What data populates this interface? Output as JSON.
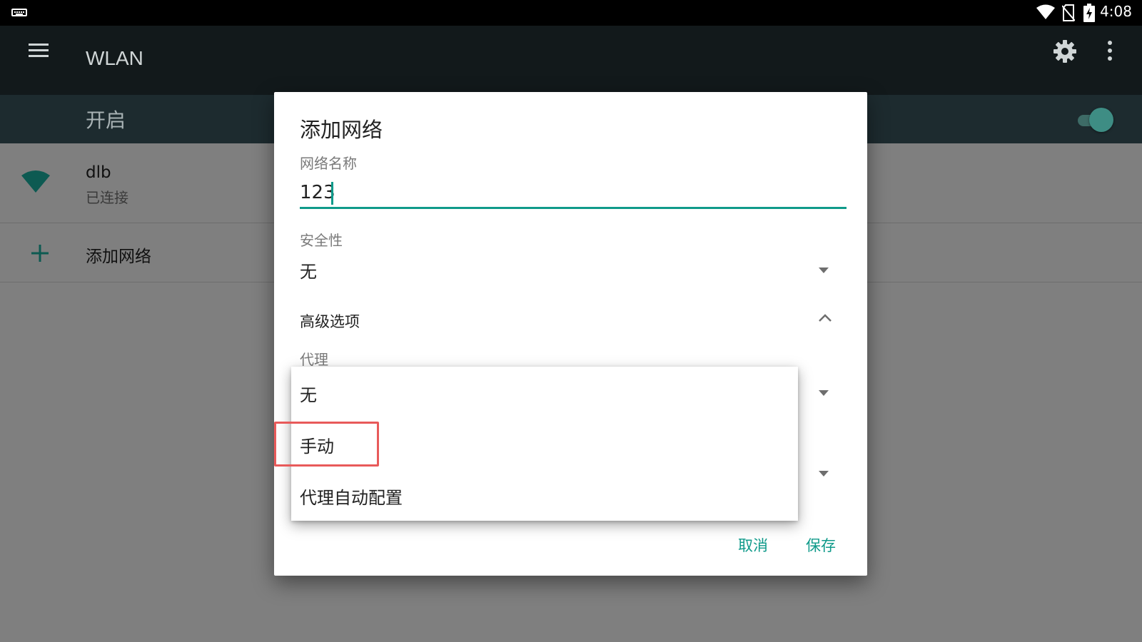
{
  "status_bar": {
    "time": "4:08"
  },
  "app_bar": {
    "title": "WLAN"
  },
  "switch_bar": {
    "label": "开启",
    "enabled": true
  },
  "networks": [
    {
      "name": "dlb",
      "status": "已连接"
    }
  ],
  "add_network_item": {
    "label": "添加网络"
  },
  "dialog": {
    "title": "添加网络",
    "ssid_label": "网络名称",
    "ssid_value": "123",
    "security_label": "安全性",
    "security_value": "无",
    "advanced_label": "高级选项",
    "proxy_label": "代理",
    "cancel_label": "取消",
    "save_label": "保存"
  },
  "proxy_dropdown": {
    "options": [
      "无",
      "手动",
      "代理自动配置"
    ],
    "highlighted_index": 1
  },
  "colors": {
    "accent": "#0f9a8a",
    "highlight_border": "#e85a5a",
    "app_bar": "#12191b",
    "switch_bar": "#1d2b2f"
  },
  "icons": [
    "keyboard-icon",
    "wifi-icon",
    "no-sim-icon",
    "battery-charging-icon",
    "menu-icon",
    "settings-gear-icon",
    "more-vert-icon",
    "wifi-signal-icon",
    "add-icon",
    "dropdown-arrow-icon",
    "chevron-up-icon"
  ]
}
